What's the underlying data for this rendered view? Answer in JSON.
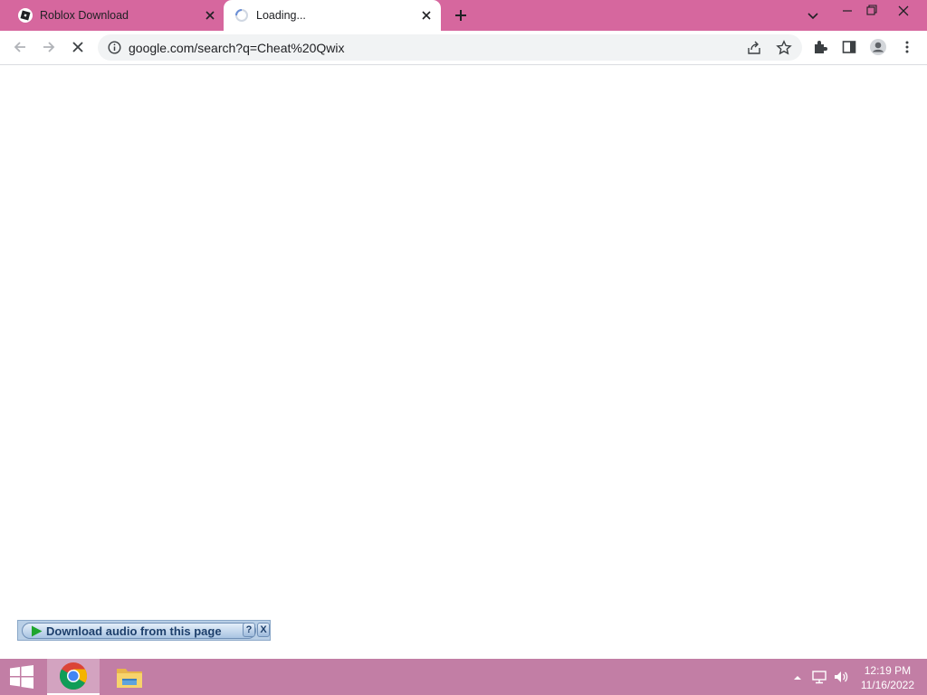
{
  "browser": {
    "tabs": [
      {
        "title": "Roblox Download",
        "active": false
      },
      {
        "title": "Loading...",
        "active": true
      }
    ],
    "new_tab_symbol": "+",
    "close_symbol": "✕",
    "url": "google.com/search?q=Cheat%20Qwix",
    "theme_color": "#d6679e"
  },
  "audio_widget": {
    "label": "Download audio from this page",
    "help_label": "?",
    "close_label": "X"
  },
  "taskbar": {
    "time": "12:19 PM",
    "date": "11/16/2022",
    "color": "#c27ea5"
  },
  "icons": [
    "roblox-icon",
    "loading-spinner-icon",
    "back-arrow-icon",
    "forward-arrow-icon",
    "stop-loading-icon",
    "info-icon",
    "share-icon",
    "star-icon",
    "extensions-icon",
    "side-panel-icon",
    "profile-icon",
    "menu-icon",
    "windows-start-icon",
    "chrome-icon",
    "file-explorer-icon",
    "tray-arrow-icon",
    "network-icon",
    "volume-icon"
  ]
}
